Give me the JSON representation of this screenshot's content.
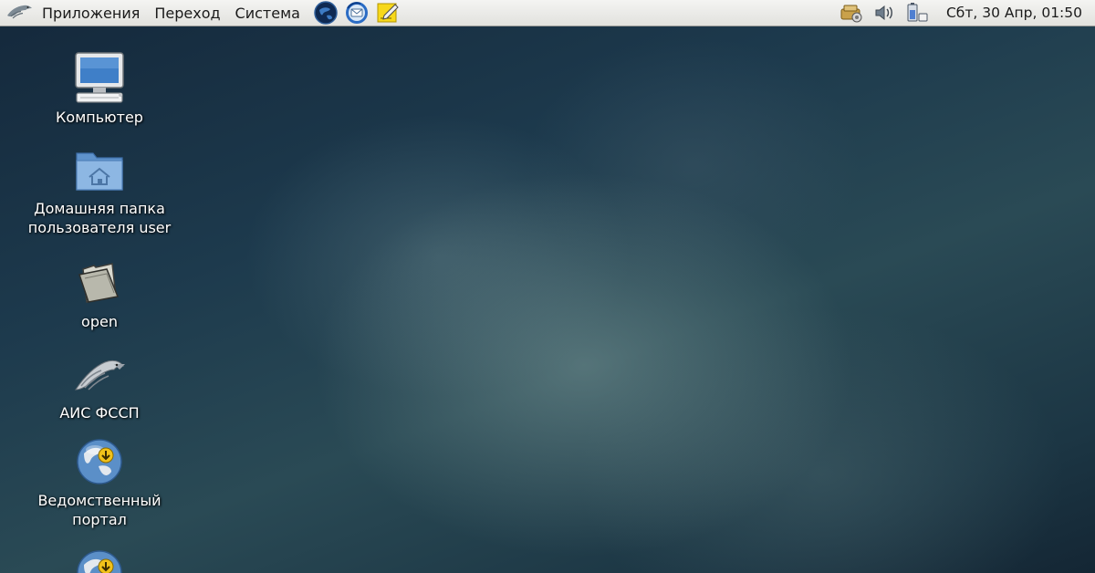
{
  "top_panel": {
    "menus": [
      "Приложения",
      "Переход",
      "Система"
    ],
    "launchers": [
      "browser-globe-icon",
      "mail-client-icon",
      "text-editor-icon"
    ],
    "tray": [
      "network-manager-icon",
      "volume-icon",
      "battery-icon"
    ],
    "clock": "Сбт, 30 Апр, 01:50"
  },
  "desktop": {
    "icons": [
      {
        "label": "Компьютер",
        "icon": "computer-icon"
      },
      {
        "label": "Домашняя папка\nпользователя user",
        "icon": "home-folder-icon"
      },
      {
        "label": "open",
        "icon": "folder-open-icon"
      },
      {
        "label": "АИС ФССП",
        "icon": "eagle-logo-icon"
      },
      {
        "label": "Ведомственный\nпортал",
        "icon": "globe-link-icon"
      }
    ]
  },
  "colors": {
    "panel_bg": "#e9e9e6",
    "desktop_dark": "#14283b",
    "desktop_mist": "#5f8284",
    "label_text": "#ffffff"
  }
}
